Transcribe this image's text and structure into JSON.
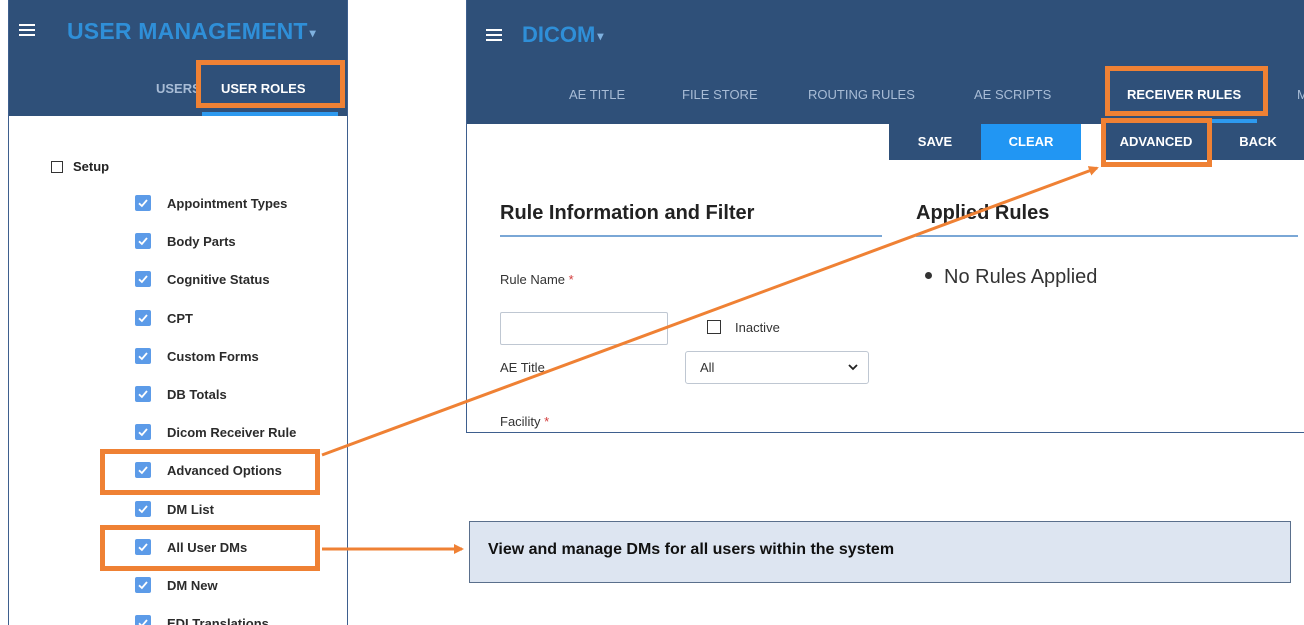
{
  "left": {
    "app_title": "USER MANAGEMENT",
    "tabs": [
      "USERS",
      "USER ROLES"
    ],
    "setup_label": "Setup",
    "permissions": [
      "Appointment Types",
      "Body Parts",
      "Cognitive Status",
      "CPT",
      "Custom Forms",
      "DB Totals",
      "Dicom Receiver Rule",
      "Advanced Options",
      "DM List",
      "All User DMs",
      "DM New",
      "EDI Translations"
    ]
  },
  "right": {
    "app_title": "DICOM",
    "tabs": [
      "AE TITLE",
      "FILE STORE",
      "ROUTING RULES",
      "AE SCRIPTS",
      "RECEIVER RULES",
      "M"
    ],
    "actions": {
      "save": "SAVE",
      "clear": "CLEAR",
      "advanced": "ADVANCED",
      "back": "BACK"
    },
    "rule_info_title": "Rule Information and Filter",
    "applied_rules_title": "Applied Rules",
    "no_rules": "No Rules Applied",
    "form": {
      "rule_name_label": "Rule Name",
      "required_marker": "*",
      "inactive_label": "Inactive",
      "ae_title_label": "AE Title",
      "ae_title_value": "All",
      "facility_label": "Facility"
    }
  },
  "callout": {
    "text": "View and manage DMs for all users within the system"
  },
  "colors": {
    "header": "#2f5079",
    "title_blue": "#2f8fd8",
    "accent_blue": "#2196f3",
    "highlight_orange": "#ef8134",
    "checkbox_blue": "#5c9be8",
    "callout_bg": "#dde5f1"
  }
}
